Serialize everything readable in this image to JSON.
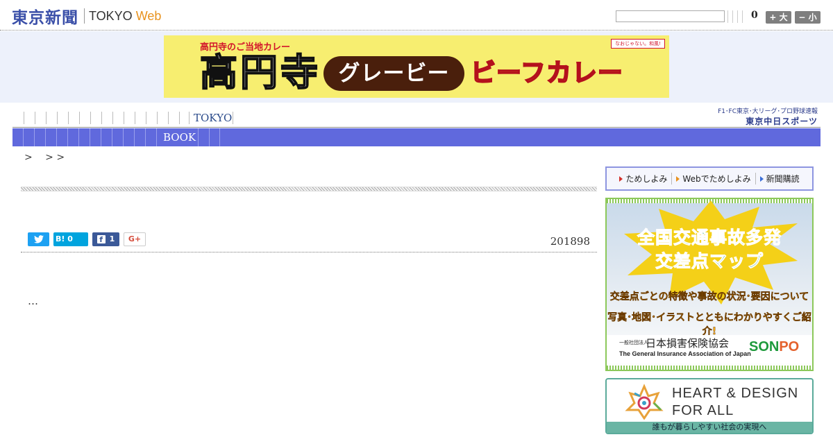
{
  "header": {
    "logo_jp": "東京新聞",
    "logo_en": "TOKYO",
    "logo_web": "Web",
    "count": "0",
    "size_up_label": "+ 大",
    "size_down_label": "− 小"
  },
  "ad_top": {
    "subtitle": "高円寺のご当地カレー",
    "stamp": "なおじゃない。和風!",
    "headline": "高円寺",
    "gravy": "グレービー",
    "beef": "ビーフカレー"
  },
  "nav_primary": {
    "label": "TOKYO"
  },
  "sports_link": {
    "line1": "F1･FC東京･大リーグ･プロ野球速報",
    "line2": "東京中日スポーツ"
  },
  "nav_secondary": {
    "label": "BOOK"
  },
  "breadcrumb": {
    "text": ">　 > >"
  },
  "article": {
    "date": "201898",
    "body": "…"
  },
  "share": {
    "twitter_icon": "twitter-bird-icon",
    "hatena_label": "B!",
    "hatena_count": "0",
    "facebook_label": "f",
    "facebook_count": "1",
    "gplus_label": "G+"
  },
  "subscribe": {
    "items": [
      "ためしよみ",
      "Webでためしよみ",
      "新聞購読"
    ]
  },
  "ad_side": {
    "headline1": "全国交通事故多発",
    "headline2": "交差点マップ",
    "desc1": "交差点ごとの特徴や事故の状況･要因について",
    "desc2": "写真･地図･イラストとともにわかりやすくご紹介!",
    "org_small": "一般社団法人",
    "org": "日本損害保険協会",
    "org_en": "The General Insurance Association of Japan",
    "brand_a": "SON",
    "brand_b": "PO"
  },
  "ad_heart": {
    "line1": "HEART & DESIGN",
    "line2": "FOR ALL",
    "tagline": "誰もが暮らしやすい社会の実現へ"
  },
  "colors": {
    "nav_blue": "#6069dd",
    "logo_blue": "#3a4fa8",
    "web_orange": "#e8921e",
    "twitter": "#1da1f2",
    "hatena": "#00a4de",
    "facebook": "#3b5998"
  }
}
